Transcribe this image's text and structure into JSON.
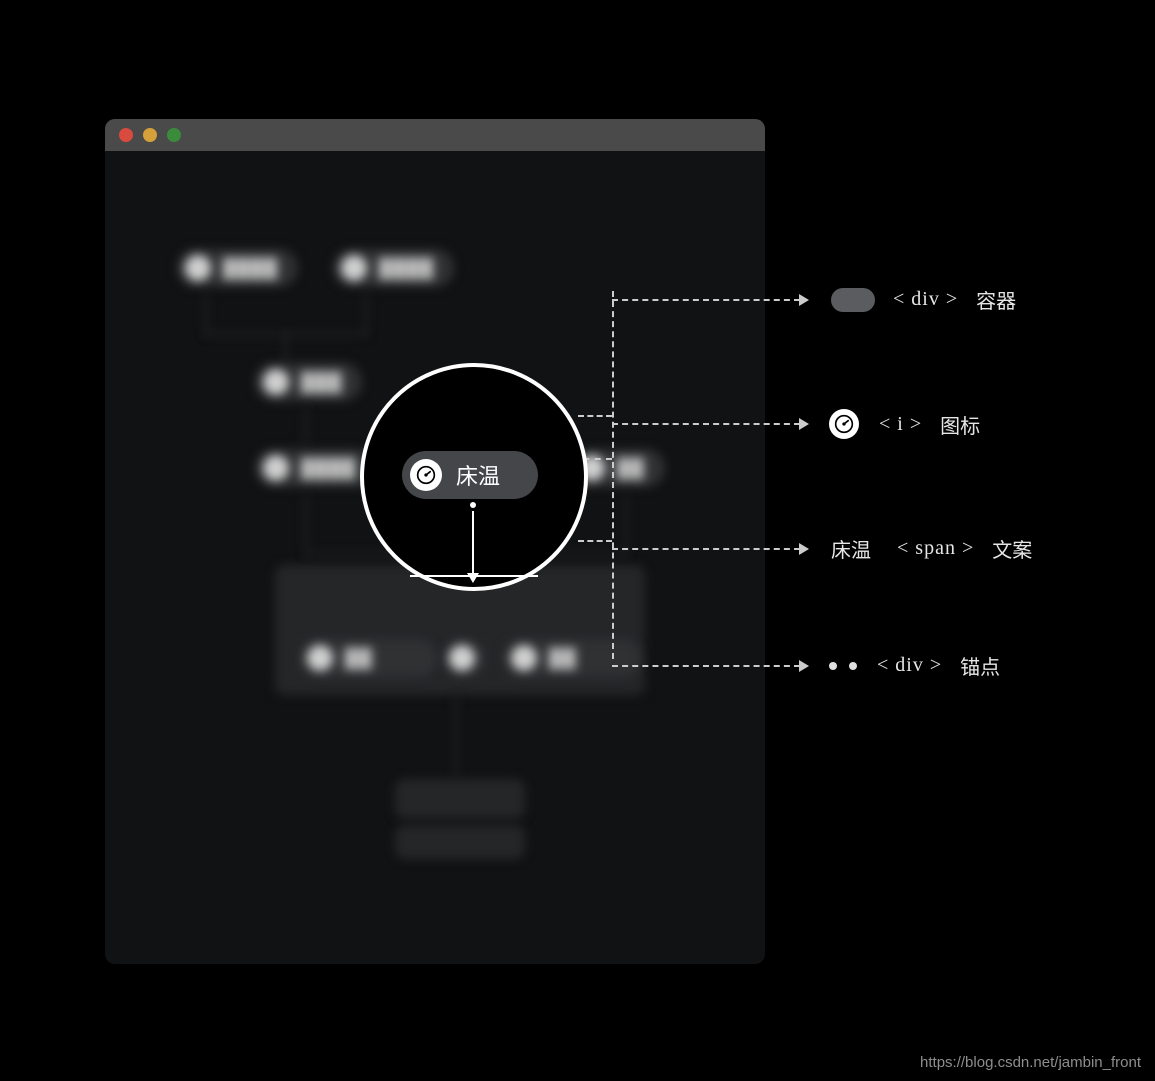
{
  "magnifier": {
    "node_label": "床温"
  },
  "callouts": {
    "container": {
      "tag": "< div >",
      "desc": "容器"
    },
    "icon": {
      "tag": "< i >",
      "desc": "图标"
    },
    "text": {
      "tag": "< span >",
      "desc": "文案",
      "sample": "床温"
    },
    "anchor": {
      "tag": "< div >",
      "desc": "锚点"
    }
  },
  "footer_url": "https://blog.csdn.net/jambin_front"
}
